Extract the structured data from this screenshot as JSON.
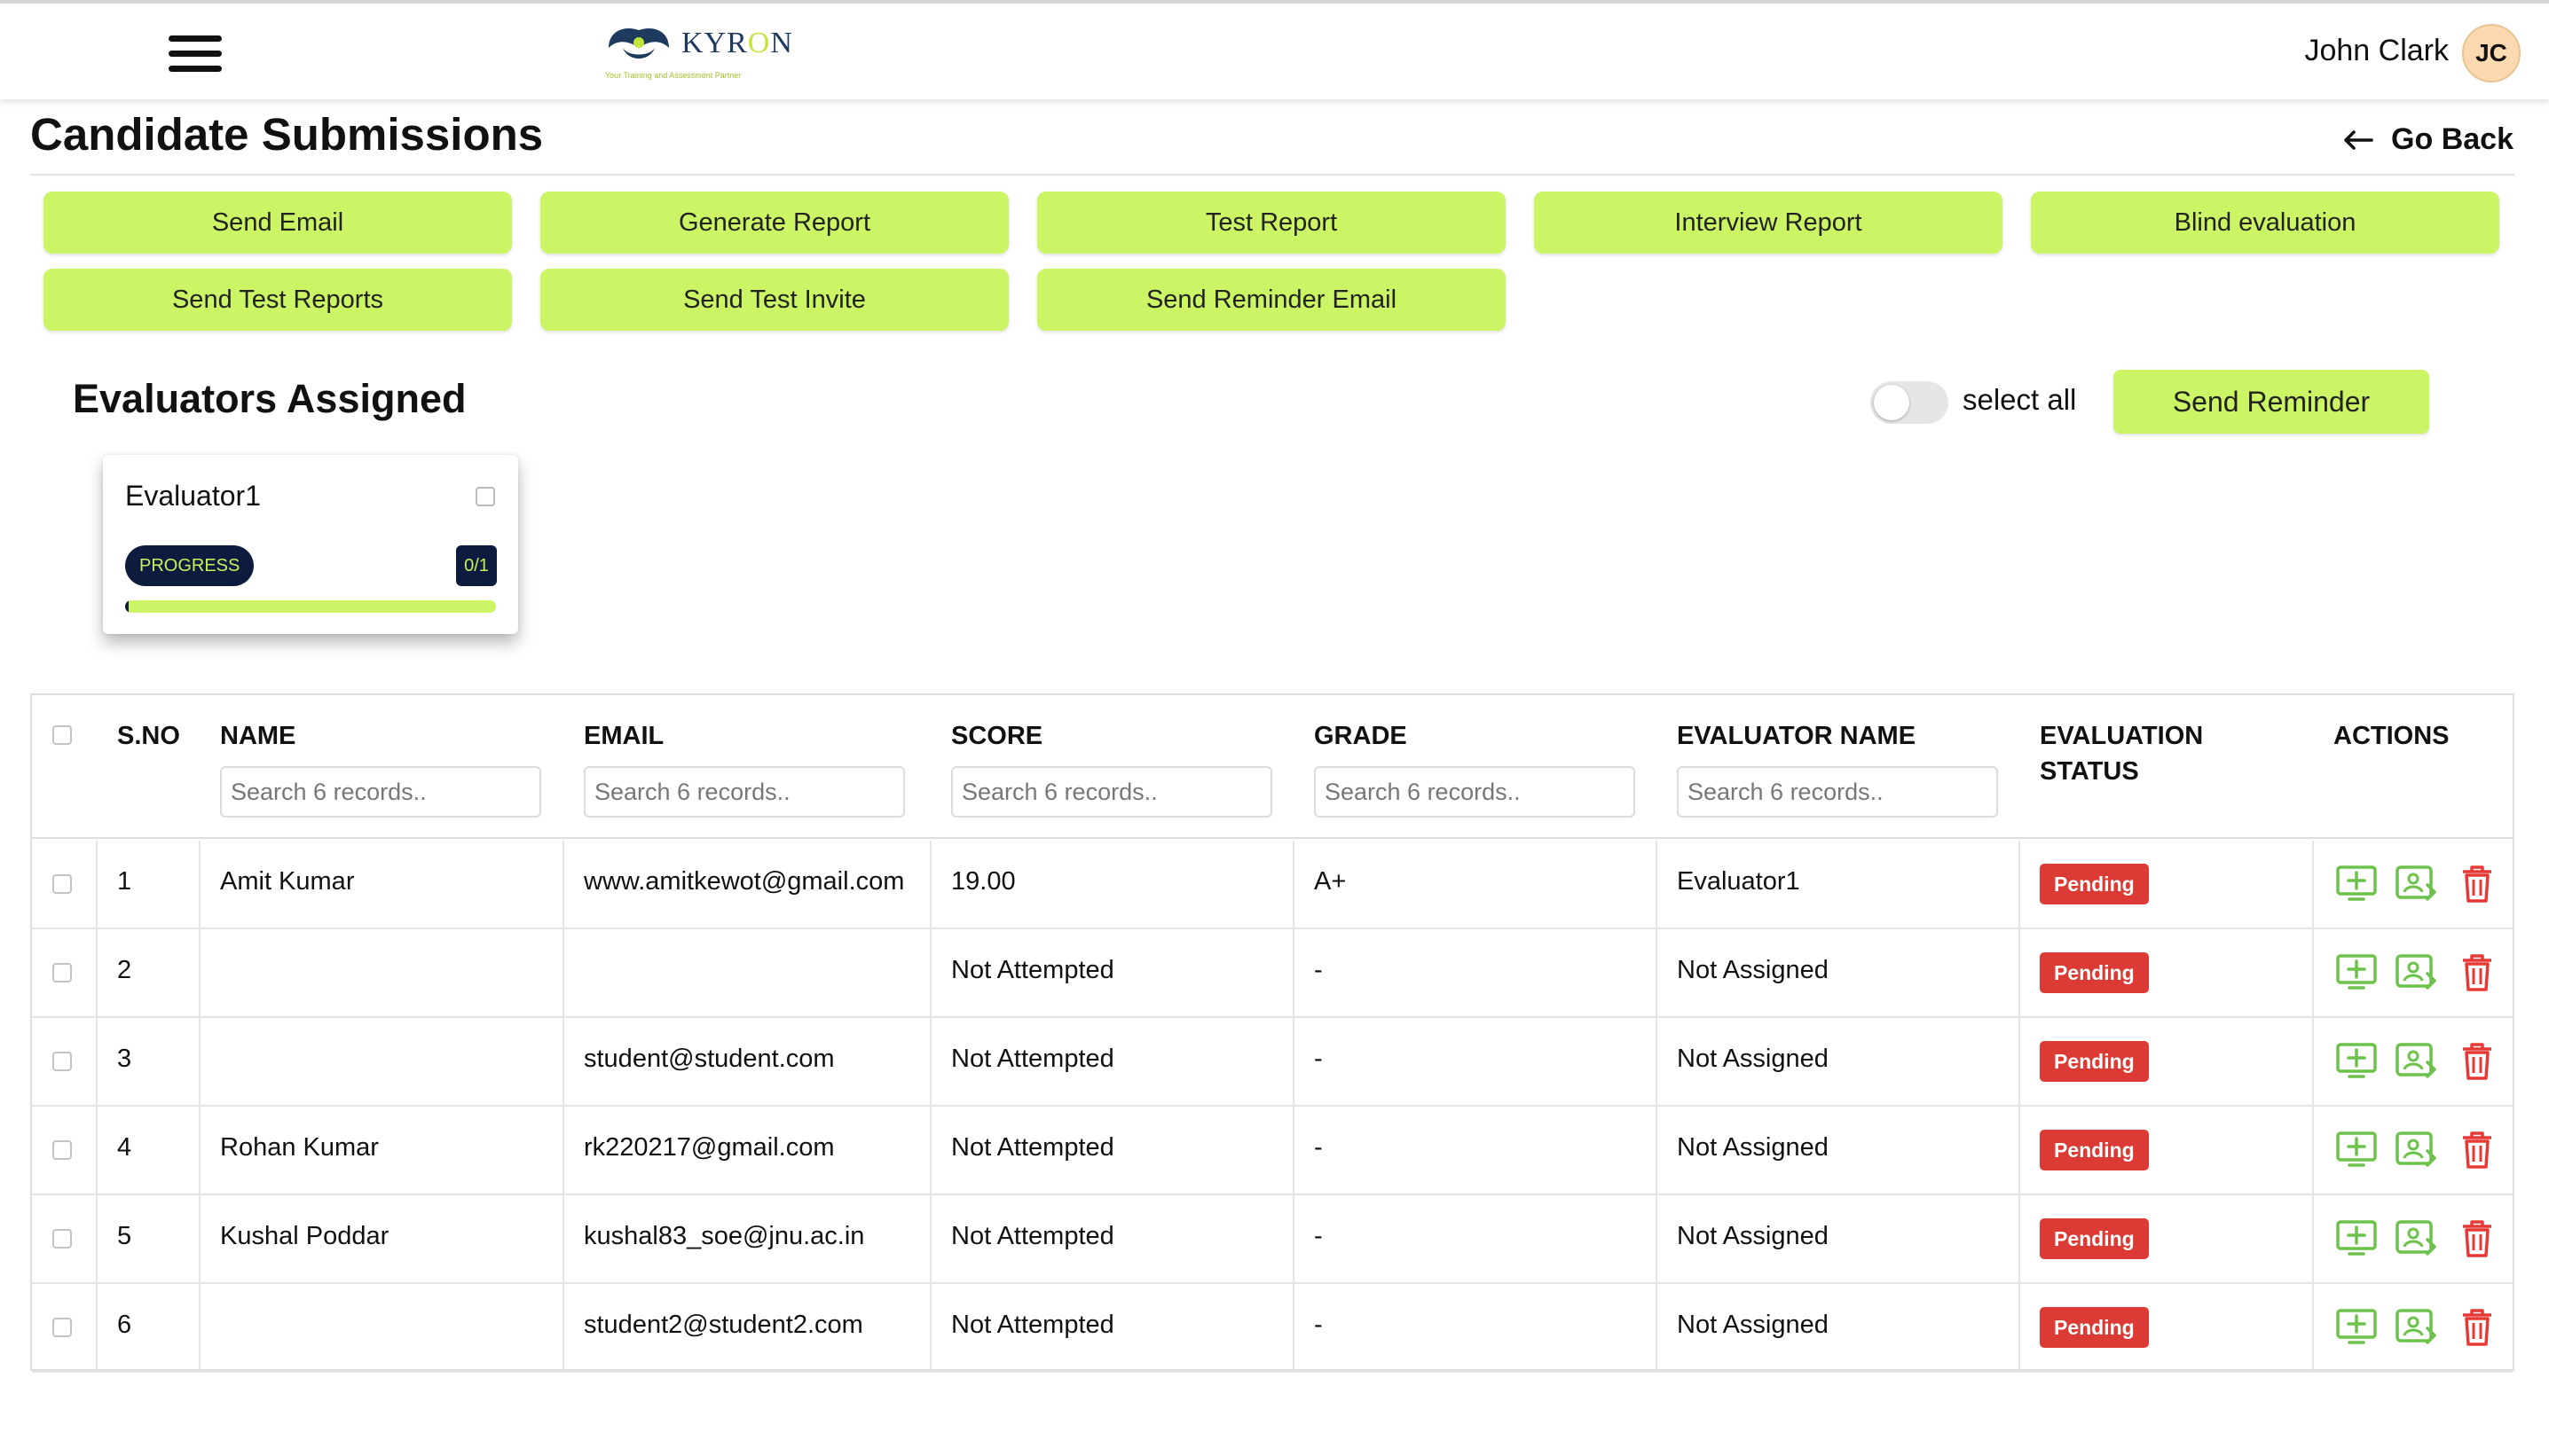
{
  "header": {
    "brand": {
      "name_prefix": "KYR",
      "name_accent": "O",
      "name_suffix": "N",
      "tagline": "Your Training and Assessment Partner"
    },
    "user": {
      "name": "John Clark",
      "initials": "JC"
    }
  },
  "page": {
    "title": "Candidate Submissions",
    "go_back_label": "Go Back"
  },
  "actions": {
    "send_email": "Send Email",
    "generate_report": "Generate Report",
    "test_report": "Test Report",
    "interview_report": "Interview Report",
    "blind_evaluation": "Blind evaluation",
    "send_test_reports": "Send Test Reports",
    "send_test_invite": "Send Test Invite",
    "send_reminder_email": "Send Reminder Email"
  },
  "evaluators": {
    "title": "Evaluators Assigned",
    "select_all_label": "select all",
    "send_reminder_label": "Send Reminder",
    "cards": [
      {
        "name": "Evaluator1",
        "progress_label": "PROGRESS",
        "count": "0/1",
        "progress_fraction": 0.0
      }
    ]
  },
  "table": {
    "columns": {
      "sno": "S.NO",
      "name": "NAME",
      "email": "EMAIL",
      "score": "SCORE",
      "grade": "GRADE",
      "evaluator": "EVALUATOR NAME",
      "status_line1": "EVALUATION",
      "status_line2": "STATUS",
      "actions": "ACTIONS"
    },
    "search_placeholder": "Search 6 records..",
    "rows": [
      {
        "sno": "1",
        "name": "Amit Kumar",
        "email": "www.amitkewot@gmail.com",
        "score": "19.00",
        "grade": "A+",
        "evaluator": "Evaluator1",
        "status": "Pending"
      },
      {
        "sno": "2",
        "name": "",
        "email": "",
        "score": "Not Attempted",
        "grade": "-",
        "evaluator": "Not Assigned",
        "status": "Pending"
      },
      {
        "sno": "3",
        "name": "",
        "email": "student@student.com",
        "score": "Not Attempted",
        "grade": "-",
        "evaluator": "Not Assigned",
        "status": "Pending"
      },
      {
        "sno": "4",
        "name": "Rohan Kumar",
        "email": "rk220217@gmail.com",
        "score": "Not Attempted",
        "grade": "-",
        "evaluator": "Not Assigned",
        "status": "Pending"
      },
      {
        "sno": "5",
        "name": "Kushal Poddar",
        "email": "kushal83_soe@jnu.ac.in",
        "score": "Not Attempted",
        "grade": "-",
        "evaluator": "Not Assigned",
        "status": "Pending"
      },
      {
        "sno": "6",
        "name": "",
        "email": "student2@student2.com",
        "score": "Not Attempted",
        "grade": "-",
        "evaluator": "Not Assigned",
        "status": "Pending"
      }
    ]
  },
  "icons": {
    "menu": "hamburger-menu-icon",
    "back": "arrow-left-icon",
    "add": "add-screen-icon",
    "assign": "assign-evaluator-icon",
    "delete": "trash-icon"
  },
  "colors": {
    "accent": "#cbf564",
    "navy": "#0d1b3e",
    "pending": "#dc3b35",
    "icon_green": "#6cc24a",
    "delete_red": "#e53935"
  }
}
